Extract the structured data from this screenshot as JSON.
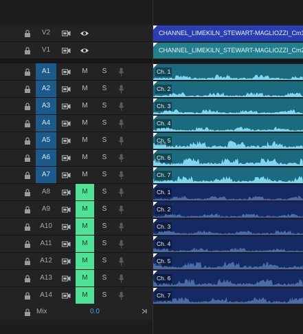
{
  "tracks": {
    "video": [
      {
        "id": "V2",
        "name": "V2",
        "visible": true,
        "clip": {
          "title": "CHANNEL_LIMEKILN_STEWART-MAGLIOZZI_Cm1_",
          "color": "#2a3eb4"
        }
      },
      {
        "id": "V1",
        "name": "V1",
        "visible": true,
        "clip": {
          "title": "CHANNEL_LIMEKILN_STEWART-MAGLIOZZI_Cm2_",
          "color": "#227f8e"
        }
      }
    ],
    "audio": [
      {
        "id": "A1",
        "name": "A1",
        "targeted": true,
        "mute": "M",
        "muted": false,
        "solo": "S",
        "clip_label": "Ch. 1",
        "level": 0.55
      },
      {
        "id": "A2",
        "name": "A2",
        "targeted": true,
        "mute": "M",
        "muted": false,
        "solo": "S",
        "clip_label": "Ch. 2",
        "level": 0.5
      },
      {
        "id": "A3",
        "name": "A3",
        "targeted": true,
        "mute": "M",
        "muted": false,
        "solo": "S",
        "clip_label": "Ch. 3",
        "level": 0.55
      },
      {
        "id": "A4",
        "name": "A4",
        "targeted": true,
        "mute": "M",
        "muted": false,
        "solo": "S",
        "clip_label": "Ch. 4",
        "level": 0.5
      },
      {
        "id": "A5",
        "name": "A5",
        "targeted": true,
        "mute": "M",
        "muted": false,
        "solo": "S",
        "clip_label": "Ch. 5",
        "level": 0.85
      },
      {
        "id": "A6",
        "name": "A6",
        "targeted": true,
        "mute": "M",
        "muted": false,
        "solo": "S",
        "clip_label": "Ch. 6",
        "level": 0.85
      },
      {
        "id": "A7",
        "name": "A7",
        "targeted": true,
        "mute": "M",
        "muted": false,
        "solo": "S",
        "clip_label": "Ch. 7",
        "level": 0.75
      },
      {
        "id": "A8",
        "name": "A8",
        "targeted": false,
        "mute": "M",
        "muted": true,
        "solo": "S",
        "clip_label": "Ch. 1",
        "level": 0.5
      },
      {
        "id": "A9",
        "name": "A9",
        "targeted": false,
        "mute": "M",
        "muted": true,
        "solo": "S",
        "clip_label": "Ch. 2",
        "level": 0.45
      },
      {
        "id": "A10",
        "name": "A10",
        "targeted": false,
        "mute": "M",
        "muted": true,
        "solo": "S",
        "clip_label": "Ch. 3",
        "level": 0.5
      },
      {
        "id": "A11",
        "name": "A11",
        "targeted": false,
        "mute": "M",
        "muted": true,
        "solo": "S",
        "clip_label": "Ch. 4",
        "level": 0.45
      },
      {
        "id": "A12",
        "name": "A12",
        "targeted": false,
        "mute": "M",
        "muted": true,
        "solo": "S",
        "clip_label": "Ch. 5",
        "level": 0.8
      },
      {
        "id": "A13",
        "name": "A13",
        "targeted": false,
        "mute": "M",
        "muted": true,
        "solo": "S",
        "clip_label": "Ch. 6",
        "level": 0.8
      },
      {
        "id": "A14",
        "name": "A14",
        "targeted": false,
        "mute": "M",
        "muted": true,
        "solo": "S",
        "clip_label": "Ch. 7",
        "level": 0.7
      }
    ]
  },
  "mix": {
    "label": "Mix",
    "value": "0.0"
  },
  "colors": {
    "target_blue": "#1c5a8a",
    "mute_green": "#4fe39a",
    "clip_teal": "#1c6a7e",
    "clip_navy": "#152a62",
    "wave_light": "#7fd6f2",
    "wave_dim": "#4b6aa8",
    "mix_value": "#3fa9f5"
  },
  "icons": {
    "lock": "lock-icon",
    "sync": "sync-lock-icon",
    "eye": "eye-icon",
    "mic": "microphone-icon",
    "mix_end": "scroll-end-icon"
  }
}
